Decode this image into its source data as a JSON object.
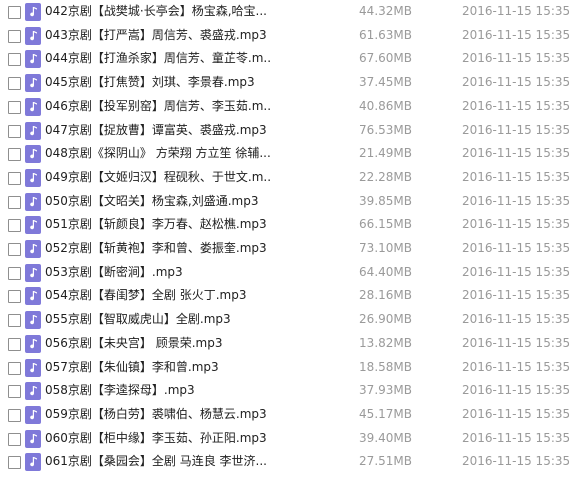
{
  "files": [
    {
      "name": "042京剧【战樊城·长亭会】杨宝森,哈宝...",
      "size": "44.32MB",
      "date": "2016-11-15 15:35"
    },
    {
      "name": "043京剧【打严嵩】周信芳、裘盛戎.mp3",
      "size": "61.63MB",
      "date": "2016-11-15 15:35"
    },
    {
      "name": "044京剧【打渔杀家】周信芳、童芷苓.m...",
      "size": "67.60MB",
      "date": "2016-11-15 15:35"
    },
    {
      "name": "045京剧【打焦赞】刘琪、李景春.mp3",
      "size": "37.45MB",
      "date": "2016-11-15 15:35"
    },
    {
      "name": "046京剧【投军别窑】周信芳、李玉茹.m...",
      "size": "40.86MB",
      "date": "2016-11-15 15:35"
    },
    {
      "name": "047京剧【捉放曹】谭富英、裘盛戎.mp3",
      "size": "76.53MB",
      "date": "2016-11-15 15:35"
    },
    {
      "name": "048京剧《探阴山》 方荣翔 方立笙 徐辅...",
      "size": "21.49MB",
      "date": "2016-11-15 15:35"
    },
    {
      "name": "049京剧【文姬归汉】程砚秋、于世文.m...",
      "size": "22.28MB",
      "date": "2016-11-15 15:35"
    },
    {
      "name": "050京剧【文昭关】杨宝森,刘盛通.mp3",
      "size": "39.85MB",
      "date": "2016-11-15 15:35"
    },
    {
      "name": "051京剧【斩颜良】李万春、赵松樵.mp3",
      "size": "66.15MB",
      "date": "2016-11-15 15:35"
    },
    {
      "name": "052京剧【斩黄袍】李和曾、娄振奎.mp3",
      "size": "73.10MB",
      "date": "2016-11-15 15:35"
    },
    {
      "name": "053京剧【断密涧】.mp3",
      "size": "64.40MB",
      "date": "2016-11-15 15:35"
    },
    {
      "name": "054京剧【春闺梦】全剧 张火丁.mp3",
      "size": "28.16MB",
      "date": "2016-11-15 15:35"
    },
    {
      "name": "055京剧【智取威虎山】全剧.mp3",
      "size": "26.90MB",
      "date": "2016-11-15 15:35"
    },
    {
      "name": "056京剧【未央宫】 顾景荣.mp3",
      "size": "13.82MB",
      "date": "2016-11-15 15:35"
    },
    {
      "name": "057京剧【朱仙镇】李和曾.mp3",
      "size": "18.58MB",
      "date": "2016-11-15 15:35"
    },
    {
      "name": "058京剧【李逵探母】.mp3",
      "size": "37.93MB",
      "date": "2016-11-15 15:35"
    },
    {
      "name": "059京剧【杨白劳】裘啸伯、杨慧云.mp3",
      "size": "45.17MB",
      "date": "2016-11-15 15:35"
    },
    {
      "name": "060京剧【柜中缘】李玉茹、孙正阳.mp3",
      "size": "39.40MB",
      "date": "2016-11-15 15:35"
    },
    {
      "name": "061京剧【桑园会】全剧 马连良 李世济...",
      "size": "27.51MB",
      "date": "2016-11-15 15:35"
    }
  ],
  "icon": "music-file-icon",
  "colors": {
    "icon_bg": "#7f79d9",
    "name_text": "#202020",
    "meta_text": "#9a9a9a",
    "checkbox_border": "#8f8f8f"
  }
}
